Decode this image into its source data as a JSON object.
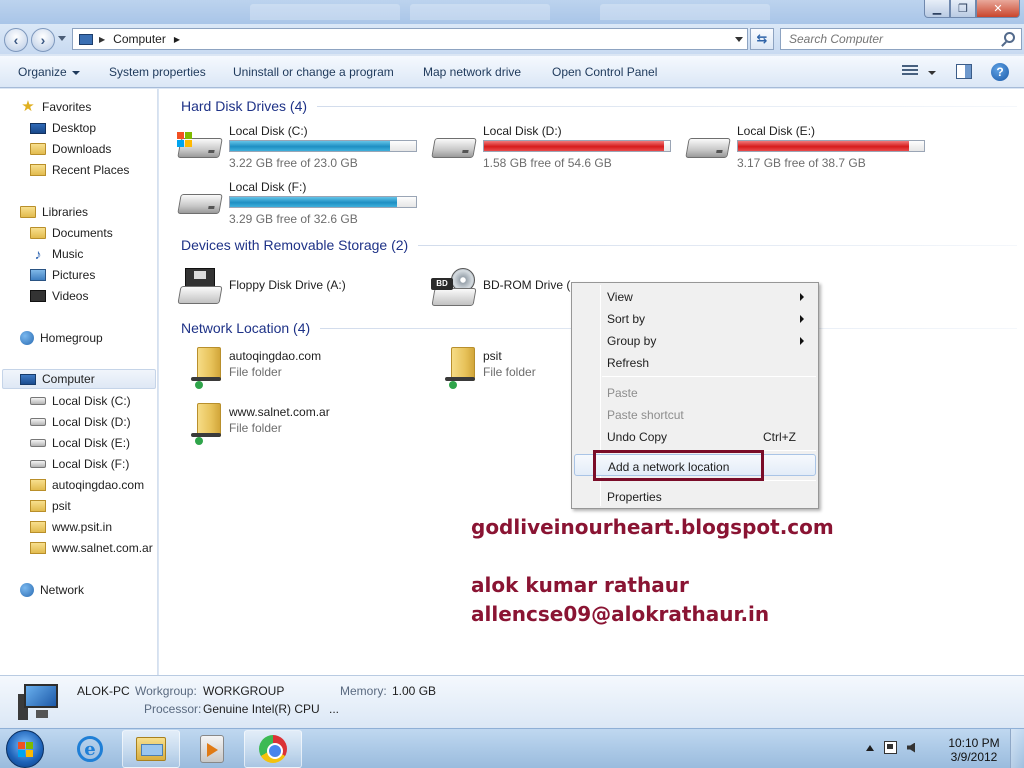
{
  "window": {
    "address": {
      "crumb": "Computer"
    },
    "search": {
      "placeholder": "Search Computer"
    }
  },
  "toolbar": {
    "organize": "Organize",
    "system_properties": "System properties",
    "uninstall": "Uninstall or change a program",
    "map_drive": "Map network drive",
    "control_panel": "Open Control Panel"
  },
  "nav": {
    "favorites": "Favorites",
    "desktop": "Desktop",
    "downloads": "Downloads",
    "recent_places": "Recent Places",
    "libraries": "Libraries",
    "documents": "Documents",
    "music": "Music",
    "pictures": "Pictures",
    "videos": "Videos",
    "homegroup": "Homegroup",
    "computer": "Computer",
    "computer_children": [
      "Local Disk (C:)",
      "Local Disk (D:)",
      "Local Disk (E:)",
      "Local Disk (F:)",
      "autoqingdao.com",
      "psit",
      "www.psit.in",
      "www.salnet.com.ar"
    ],
    "network": "Network"
  },
  "content": {
    "hard_disks": {
      "header": "Hard Disk Drives (4)",
      "drives": [
        {
          "name": "Local Disk (C:)",
          "free": "3.22 GB free of 23.0 GB",
          "used_fraction": 0.86,
          "color": "#1e8fc3"
        },
        {
          "name": "Local Disk (D:)",
          "free": "1.58 GB free of 54.6 GB",
          "used_fraction": 0.97,
          "color": "#d61c1c"
        },
        {
          "name": "Local Disk (E:)",
          "free": "3.17 GB free of 38.7 GB",
          "used_fraction": 0.92,
          "color": "#d61c1c"
        },
        {
          "name": "Local Disk (F:)",
          "free": "3.29 GB free of 32.6 GB",
          "used_fraction": 0.9,
          "color": "#1e8fc3"
        }
      ]
    },
    "removable": {
      "header": "Devices with Removable Storage (2)",
      "devices": [
        {
          "name": "Floppy Disk Drive (A:)"
        },
        {
          "name": "BD-ROM Drive (",
          "badge": "BD"
        }
      ]
    },
    "network": {
      "header": "Network Location (4)",
      "items": [
        {
          "name": "autoqingdao.com",
          "type": "File folder"
        },
        {
          "name": "psit",
          "type": "File folder"
        },
        {
          "name": "www.salnet.com.ar",
          "type": "File folder"
        }
      ]
    }
  },
  "context_menu": {
    "view": "View",
    "sort_by": "Sort by",
    "group_by": "Group by",
    "refresh": "Refresh",
    "paste": "Paste",
    "paste_shortcut": "Paste shortcut",
    "undo_copy": "Undo Copy",
    "undo_shortcut": "Ctrl+Z",
    "add_network_location": "Add a network location",
    "properties": "Properties"
  },
  "watermark": {
    "blog": "godliveinourheart.blogspot.com",
    "author": "alok kumar rathaur",
    "email": "allencse09@alokrathaur.in"
  },
  "details": {
    "pc_name": "ALOK-PC",
    "workgroup_label": "Workgroup:",
    "workgroup": "WORKGROUP",
    "memory_label": "Memory:",
    "memory": "1.00 GB",
    "processor_label": "Processor:",
    "processor": "Genuine Intel(R) CPU",
    "processor_more": "..."
  },
  "taskbar": {
    "time": "10:10 PM",
    "date": "3/9/2012"
  },
  "colors": {
    "accent_header": "#1e3287",
    "watermark": "#8a1433",
    "highlight_box": "#7a0c28"
  }
}
